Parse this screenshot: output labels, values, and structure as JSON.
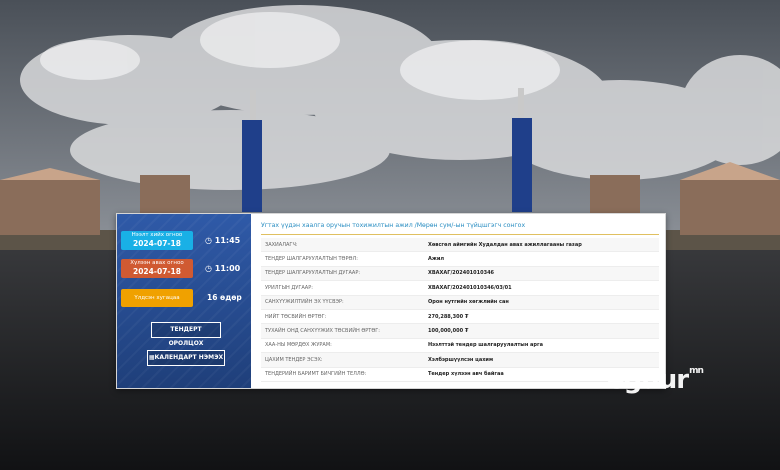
{
  "pills": {
    "open_label": "Нээлт хийх огноо",
    "open_date": "2024-07-18",
    "open_time": "11:45",
    "close_label": "Хүлээн авах огноо",
    "close_date": "2024-07-18",
    "close_time": "11:00",
    "days_label": "Үлдсэн хугацаа",
    "days_value": "16 өдөр"
  },
  "buttons": {
    "join": "ТЕНДЕРТ ОРОЛЦОХ",
    "calendar": "КАЛЕНДАРТ НЭМЭХ"
  },
  "details": {
    "title": "Угтах үүдэн хаалга оручын тохижилтын ажил /Мөрөн сум/-ын түйцшгэгч сонгох",
    "rows": [
      {
        "k": "ЗАХИАЛАГЧ:",
        "v": "Хөвсгөл аймгийн Худалдан авах ажиллагааны газар"
      },
      {
        "k": "ТЕНДЕР ШАЛГАРУУЛАЛТЫН ТӨРӨЛ:",
        "v": "Ажил"
      },
      {
        "k": "ТЕНДЕР ШАЛГАРУУЛАЛТЫН ДУГААР:",
        "v": "ХВАХАГ/202401010346"
      },
      {
        "k": "УРИЛГЫН ДУГААР:",
        "v": "ХВАХАГ/202401010346/03/01"
      },
      {
        "k": "САНХҮҮЖИЛТИЙН ЭХ ҮҮСВЭР:",
        "v": "Орон нутгийн хөгжлийн сан"
      },
      {
        "k": "НИЙТ ТӨСВИЙН ӨРТӨГ:",
        "v": "270,288,300 ₮"
      },
      {
        "k": "ТУХАЙН ОНД САНХҮҮЖИХ ТӨСВИЙН ӨРТӨГ:",
        "v": "100,000,000 ₮"
      },
      {
        "k": "ХАА-НЫ МӨРДӨХ ЖУРАМ:",
        "v": "Нээлттэй тендер шалгаруулалтын арга"
      },
      {
        "k": "ЦАХИМ ТЕНДЕР ЭСЭХ:",
        "v": "Хэлбэршүүлсэн цахим"
      },
      {
        "k": "ТЕНДЕРИЙН БАРИМТ БИЧГИЙН ТЕЛЛӨ:",
        "v": "Тендер хүлээн авч байгаа"
      }
    ]
  },
  "logo": {
    "main": "eguur",
    "suffix": "mn"
  }
}
